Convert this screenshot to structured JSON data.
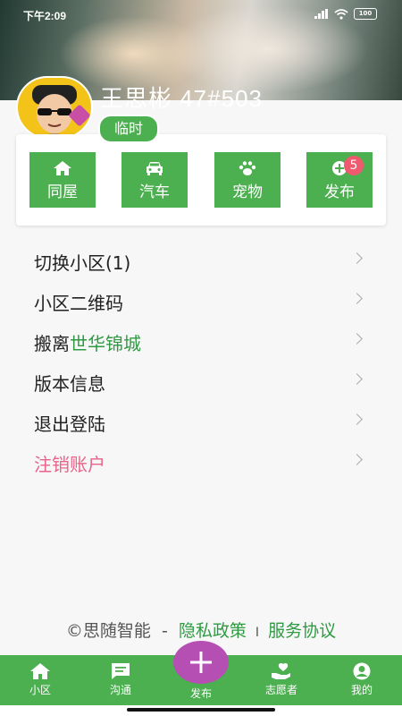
{
  "status_bar": {
    "time": "下午2:09",
    "battery": "100"
  },
  "profile": {
    "name": "王思彬  47#503",
    "tag": "临时"
  },
  "quick_actions": [
    {
      "label": "同屋",
      "icon": "home-icon"
    },
    {
      "label": "汽车",
      "icon": "car-icon"
    },
    {
      "label": "宠物",
      "icon": "paw-icon"
    },
    {
      "label": "发布",
      "icon": "add-circle-icon",
      "badge": "5"
    }
  ],
  "menu": {
    "switch": "切换小区(1)",
    "qrcode": "小区二维码",
    "move_prefix": "搬离",
    "move_highlight": "世华锦城",
    "version": "版本信息",
    "logout": "退出登陆",
    "cancel_account": "注销账户"
  },
  "footer": {
    "company": "©思随智能",
    "dash": "-",
    "privacy": "隐私政策",
    "sep": "I",
    "terms": "服务协议"
  },
  "bottom_nav": {
    "community": "小区",
    "chat": "沟通",
    "publish": "发布",
    "volunteer": "志愿者",
    "mine": "我的"
  },
  "colors": {
    "primary": "#4caf50",
    "accent_text": "#2e9b43",
    "danger": "#e8638a",
    "fab": "#b64fb4",
    "badge": "#ef5a6f"
  }
}
